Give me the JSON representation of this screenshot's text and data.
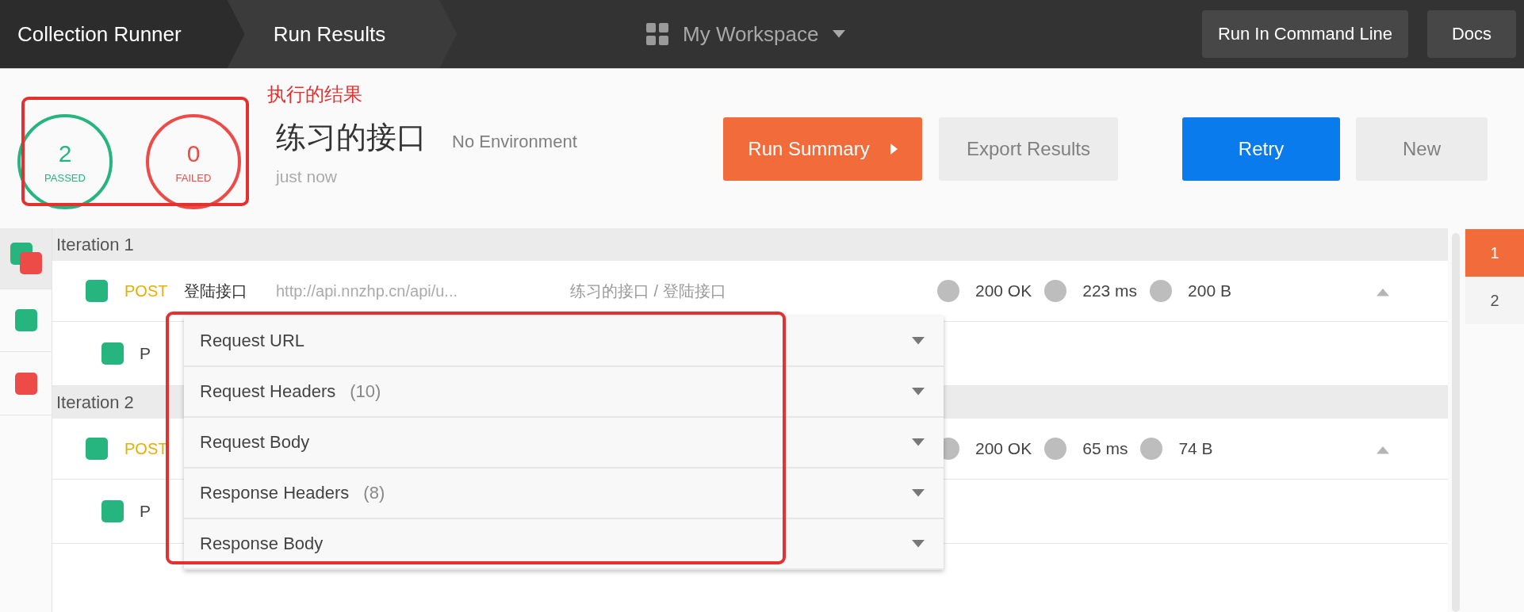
{
  "top_bar": {
    "breadcrumbs": [
      {
        "label": "Collection Runner",
        "selected": false
      },
      {
        "label": "Run Results",
        "selected": true
      }
    ],
    "workspace": "My Workspace",
    "buttons": [
      "Run In Command Line",
      "Docs"
    ]
  },
  "summary": {
    "stats": [
      {
        "kind": "passed",
        "count": "2",
        "label": "PASSED"
      },
      {
        "kind": "failed",
        "count": "0",
        "label": "FAILED"
      }
    ],
    "annotation": "执行的结果",
    "collection": "练习的接口",
    "environment": "No Environment",
    "time": "just now",
    "buttons": [
      {
        "label": "Run Summary",
        "kind": "summary"
      },
      {
        "label": "Export Results",
        "kind": "plain"
      },
      {
        "label": "Retry",
        "kind": "primary"
      },
      {
        "label": "New",
        "kind": "secondary"
      }
    ]
  },
  "sidebar": [
    {
      "kind": "mixed",
      "selected": true
    },
    {
      "kind": "passed",
      "selected": false
    },
    {
      "kind": "failed",
      "selected": false
    }
  ],
  "iterations": [
    {
      "title": "Iteration 1",
      "request": {
        "kind": "passed",
        "method": "POST",
        "name": "登陆接口",
        "url": "http://api.nnzhp.cn/api/u...",
        "path": "练习的接口 / 登陆接口",
        "metrics": [
          "200 OK",
          "223 ms",
          "200 B"
        ]
      },
      "tests": [
        {
          "kind": "passed",
          "name": "P"
        }
      ]
    },
    {
      "title": "Iteration 2",
      "request": {
        "kind": "passed",
        "method": "POST",
        "metrics": [
          "200 OK",
          "65 ms",
          "74 B"
        ]
      },
      "tests": [
        {
          "kind": "passed",
          "name": "P"
        }
      ]
    }
  ],
  "details_menu": [
    {
      "label": "Request URL"
    },
    {
      "label": "Request Headers",
      "count": "(10)"
    },
    {
      "label": "Request Body"
    },
    {
      "label": "Response Headers",
      "count": "(8)"
    },
    {
      "label": "Response Body"
    }
  ],
  "iteration_tabs": [
    {
      "label": "1",
      "selected": true
    },
    {
      "label": "2",
      "selected": false
    }
  ]
}
